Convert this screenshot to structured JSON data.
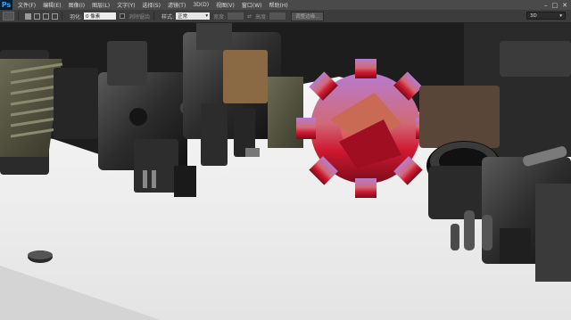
{
  "app": {
    "logo": "Ps"
  },
  "menubar": {
    "items": [
      {
        "label": "文件(F)"
      },
      {
        "label": "编辑(E)"
      },
      {
        "label": "图像(I)"
      },
      {
        "label": "图层(L)"
      },
      {
        "label": "文字(Y)"
      },
      {
        "label": "选择(S)"
      },
      {
        "label": "滤镜(T)"
      },
      {
        "label": "3D(D)"
      },
      {
        "label": "视图(V)"
      },
      {
        "label": "窗口(W)"
      },
      {
        "label": "帮助(H)"
      }
    ],
    "window_controls": {
      "minimize": "–",
      "restore": "□",
      "close": "✕"
    }
  },
  "options_bar": {
    "feather_label": "羽化:",
    "feather_value": "0 像素",
    "antialias_label": "消除锯齿",
    "style_label": "样式:",
    "style_value": "正常",
    "width_label": "宽度:",
    "height_label": "高度:",
    "refine_edge_label": "调整边缘...",
    "workspace_value": "3D"
  },
  "colors": {
    "menubar_bg": "#4a4a4a",
    "optbar_bg": "#3c3c3c",
    "canvas_bg": "#f2f2f2",
    "gear_red": "#c8102e",
    "gear_purple": "#a56cc1"
  }
}
